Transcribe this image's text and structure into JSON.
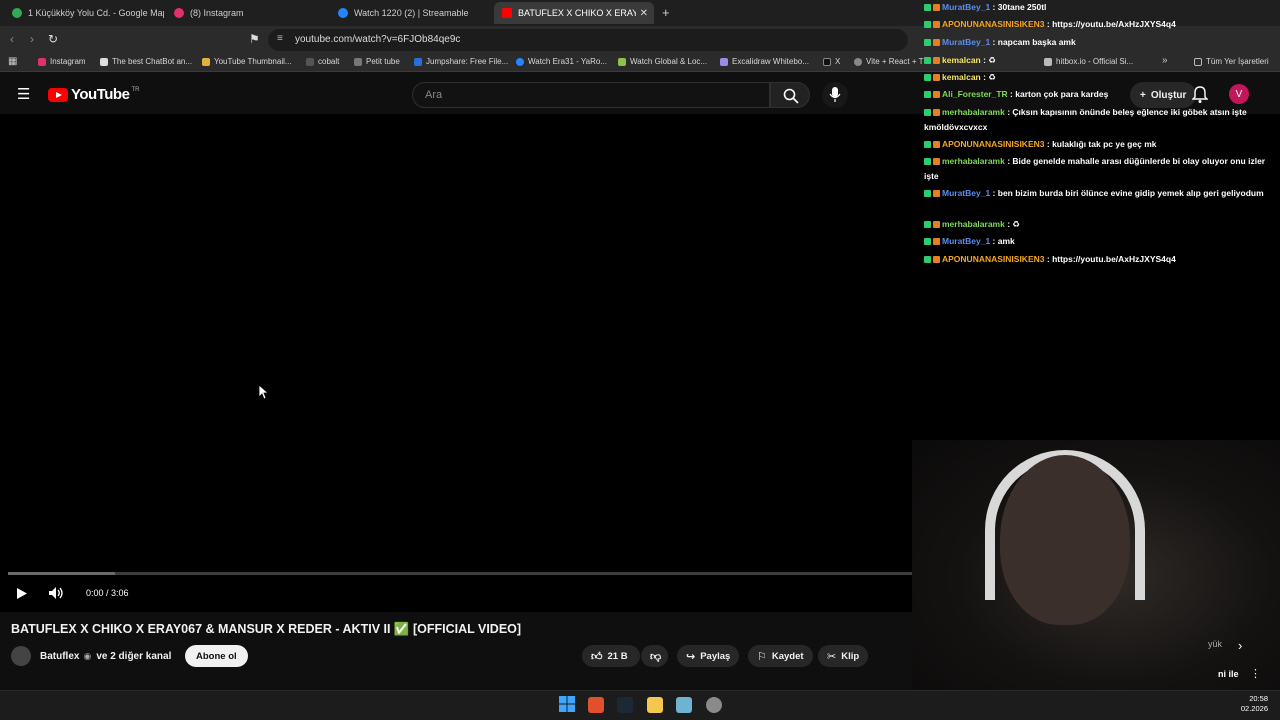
{
  "tabs": [
    {
      "title": "1 Küçükköy Yolu Cd. - Google Maps",
      "color": "#34a853",
      "active": false
    },
    {
      "title": "(8) Instagram",
      "color": "#e1306c",
      "active": false
    },
    {
      "title": "Watch 1220 (2) | Streamable",
      "color": "#2684ff",
      "active": false
    },
    {
      "title": "BATUFLEX X CHIKO X ERAY067 &",
      "color": "#ff0000",
      "active": true
    }
  ],
  "browser": {
    "url": "youtube.com/watch?v=6FJOb84qe9c",
    "all_bookmarks": "Tüm Yer İşaretleri"
  },
  "bookmarks": [
    "Instagram",
    "The best ChatBot an...",
    "YouTube Thumbnail...",
    "cobalt",
    "Petit tube",
    "Jumpshare: Free File...",
    "Watch Era31 - YaRo...",
    "Watch Global & Loc...",
    "Excalidraw Whitebo...",
    "X",
    "Vite + React + T",
    "hitbox.io - Official Si..."
  ],
  "youtube": {
    "logo_text": "YouTube",
    "region": "TR",
    "search_placeholder": "Ara",
    "create_label": "Oluştur",
    "avatar_letter": "V"
  },
  "player": {
    "time": "0:00 / 3:06",
    "buffered_fraction": 0.085
  },
  "video": {
    "title": "BATUFLEX X CHIKO X ERAY067 & MANSUR X REDER - AKTIV II ✅ [OFFICIAL VIDEO]",
    "channel": "Batuflex",
    "channel_extra": "ve 2 diğer kanal",
    "subscribe": "Abone ol",
    "likes": "21 B",
    "share": "Paylaş",
    "save": "Kaydet",
    "clip": "Klip",
    "partial_right_1": "yük",
    "partial_right_2": "ni ile"
  },
  "chat": [
    {
      "user": "MuratBey_1",
      "text": "30tane 250tl",
      "color": "#5b8def"
    },
    {
      "user": "APONUNANASINISIKEN3",
      "text": "https://youtu.be/AxHzJXYS4q4",
      "color": "#f5a623"
    },
    {
      "user": "MuratBey_1",
      "text": "napcam başka amk",
      "color": "#5b8def"
    },
    {
      "user": "kemalcan",
      "text": "♻",
      "color": "#f5e663"
    },
    {
      "user": "kemalcan",
      "text": "♻",
      "color": "#f5e663"
    },
    {
      "user": "Ali_Forester_TR",
      "text": "karton çok para kardeş",
      "color": "#7ed957"
    },
    {
      "user": "merhabalaramk",
      "text": "Çıksın kapısının önünde beleş eğlence iki göbek atsın işte kmöldövxcvxcx",
      "color": "#7ed957"
    },
    {
      "user": "APONUNANASINISIKEN3",
      "text": "kulaklığı tak pc ye geç mk",
      "color": "#f5a623"
    },
    {
      "user": "merhabalaramk",
      "text": "Bide genelde mahalle arası düğünlerde bi olay oluyor onu izler işte",
      "color": "#7ed957"
    },
    {
      "user": "MuratBey_1",
      "text": "ben bizim burda biri ölünce evine gidip yemek alıp geri geliyodum",
      "color": "#5b8def"
    },
    {
      "user": "merhabalaramk",
      "text": "♻",
      "color": "#7ed957"
    },
    {
      "user": "MuratBey_1",
      "text": "amk",
      "color": "#5b8def"
    },
    {
      "user": "APONUNANASINISIKEN3",
      "text": "https://youtu.be/AxHzJXYS4q4",
      "color": "#f5a623"
    }
  ],
  "clock": {
    "time": "20:58",
    "date": "02.2026"
  }
}
